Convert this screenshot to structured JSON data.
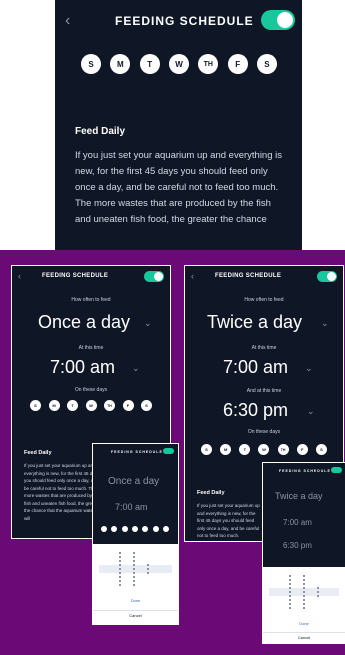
{
  "top_screen": {
    "title": "FEEDING SCHEDULE",
    "days": [
      "S",
      "M",
      "T",
      "W",
      "TH",
      "F",
      "S"
    ],
    "feed_title": "Feed Daily",
    "feed_text": "If you just set your aquarium up and everything is new, for the first 45 days you should feed only once a day, and be careful not to feed too much. The more wastes that are produced by the fish and uneaten fish food, the greater the chance",
    "toggle_on": true
  },
  "left_screen": {
    "title": "FEEDING SCHEDULE",
    "question": "How often to feed",
    "frequency": "Once a day",
    "time_label": "At this time",
    "time": "7:00 am",
    "days_label": "On these days",
    "days": [
      "S",
      "M",
      "T",
      "W",
      "TH",
      "F",
      "S"
    ],
    "feed_title": "Feed Daily",
    "feed_text": "If you just set your aquarium up and everything is new, for the first 45 days you should feed only once a day, and be careful not to feed too much. The more wastes that are produced by the fish and uneaten fish food, the greater the chance that the aquarium water will"
  },
  "left_popup": {
    "title": "FEEDING SCHEDULE",
    "frequency": "Once a day",
    "time": "7:00 am",
    "done_label": "Done",
    "cancel_label": "Cancel"
  },
  "right_screen": {
    "title": "FEEDING SCHEDULE",
    "question": "How often to feed",
    "frequency": "Twice a day",
    "time_label": "At this time",
    "time": "7:00 am",
    "second_time_label": "And at this time",
    "second_time": "6:30 pm",
    "days_label": "On these days",
    "days": [
      "S",
      "M",
      "T",
      "W",
      "TH",
      "F",
      "S"
    ],
    "feed_title": "Feed Daily",
    "feed_text": "If you just set your aquarium up and everything is new, for the first 45 days you should feed only once a day, and be careful not to feed too much."
  },
  "right_popup": {
    "title": "FEEDING SCHEDULE",
    "frequency": "Twice a day",
    "time": "7:00 am",
    "second_time": "6:30 pm",
    "done_label": "Done",
    "cancel_label": "Cancel"
  },
  "colors": {
    "navy": "#0f1727",
    "accent": "#18c79b",
    "purple": "#6b0a77",
    "white": "#ffffff"
  }
}
